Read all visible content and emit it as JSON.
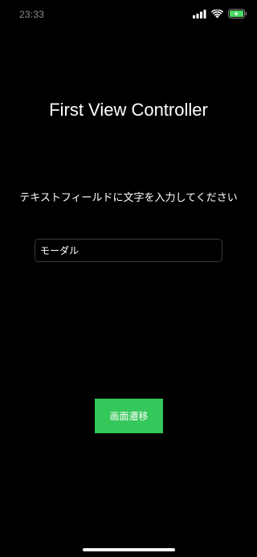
{
  "status_bar": {
    "time": "23:33",
    "icons": [
      "signal-icon",
      "wifi-icon",
      "battery-charging-icon"
    ],
    "battery_color": "#4cd964"
  },
  "main": {
    "title": "First View Controller",
    "instruction": "テキストフィールドに文字を入力してください",
    "text_field": {
      "value": "モーダル",
      "placeholder": ""
    },
    "button_label": "画面遷移",
    "button_color": "#34c759"
  }
}
